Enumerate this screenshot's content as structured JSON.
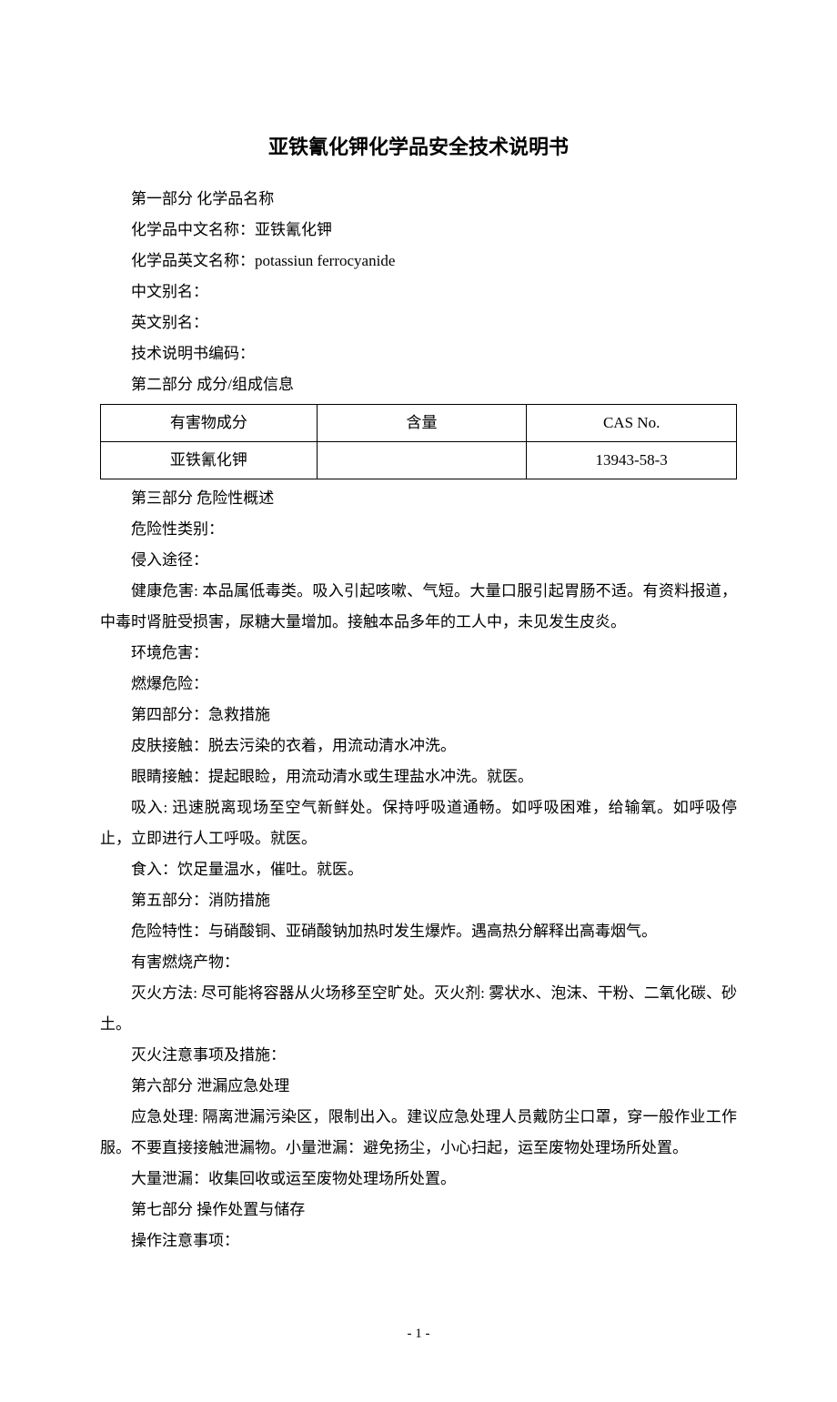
{
  "title": "亚铁氰化钾化学品安全技术说明书",
  "section1": {
    "heading": "第一部分  化学品名称",
    "cn_name_label": "化学品中文名称：亚铁氰化钾",
    "en_name_label": "化学品英文名称：",
    "en_name_value": "potassiun ferrocyanide",
    "cn_alias": "中文别名：",
    "en_alias": "英文别名：",
    "manual_no": "技术说明书编码："
  },
  "section2": {
    "heading": "第二部分  成分/组成信息",
    "table": {
      "headers": [
        "有害物成分",
        "含量",
        "CAS No."
      ],
      "row": [
        "亚铁氰化钾",
        "",
        "13943-58-3"
      ]
    }
  },
  "section3": {
    "heading": "第三部分  危险性概述",
    "class": "危险性类别：",
    "route": "侵入途径：",
    "health": "健康危害: 本品属低毒类。吸入引起咳嗽、气短。大量口服引起胃肠不适。有资料报道，中毒时肾脏受损害，尿糖大量增加。接触本品多年的工人中，未见发生皮炎。",
    "env": "环境危害：",
    "explode": "燃爆危险："
  },
  "section4": {
    "heading": "第四部分：急救措施",
    "skin": "皮肤接触：脱去污染的衣着，用流动清水冲洗。",
    "eye": "眼睛接触：提起眼睑，用流动清水或生理盐水冲洗。就医。",
    "inhale": "吸入: 迅速脱离现场至空气新鲜处。保持呼吸道通畅。如呼吸困难，给输氧。如呼吸停止，立即进行人工呼吸。就医。",
    "ingest": "食入：饮足量温水，催吐。就医。"
  },
  "section5": {
    "heading": "第五部分：消防措施",
    "hazard": "危险特性：与硝酸铜、亚硝酸钠加热时发生爆炸。遇高热分解释出高毒烟气。",
    "product": "有害燃烧产物：",
    "method": "灭火方法: 尽可能将容器从火场移至空旷处。灭火剂: 雾状水、泡沫、干粉、二氧化碳、砂土。",
    "note": "灭火注意事项及措施："
  },
  "section6": {
    "heading": "第六部分  泄漏应急处理",
    "emergency": "应急处理: 隔离泄漏污染区，限制出入。建议应急处理人员戴防尘口罩，穿一般作业工作服。不要直接接触泄漏物。小量泄漏：避免扬尘，小心扫起，运至废物处理场所处置。",
    "large": "大量泄漏：收集回收或运至废物处理场所处置。"
  },
  "section7": {
    "heading": "第七部分  操作处置与储存",
    "op": "操作注意事项："
  },
  "page_number": "- 1 -"
}
